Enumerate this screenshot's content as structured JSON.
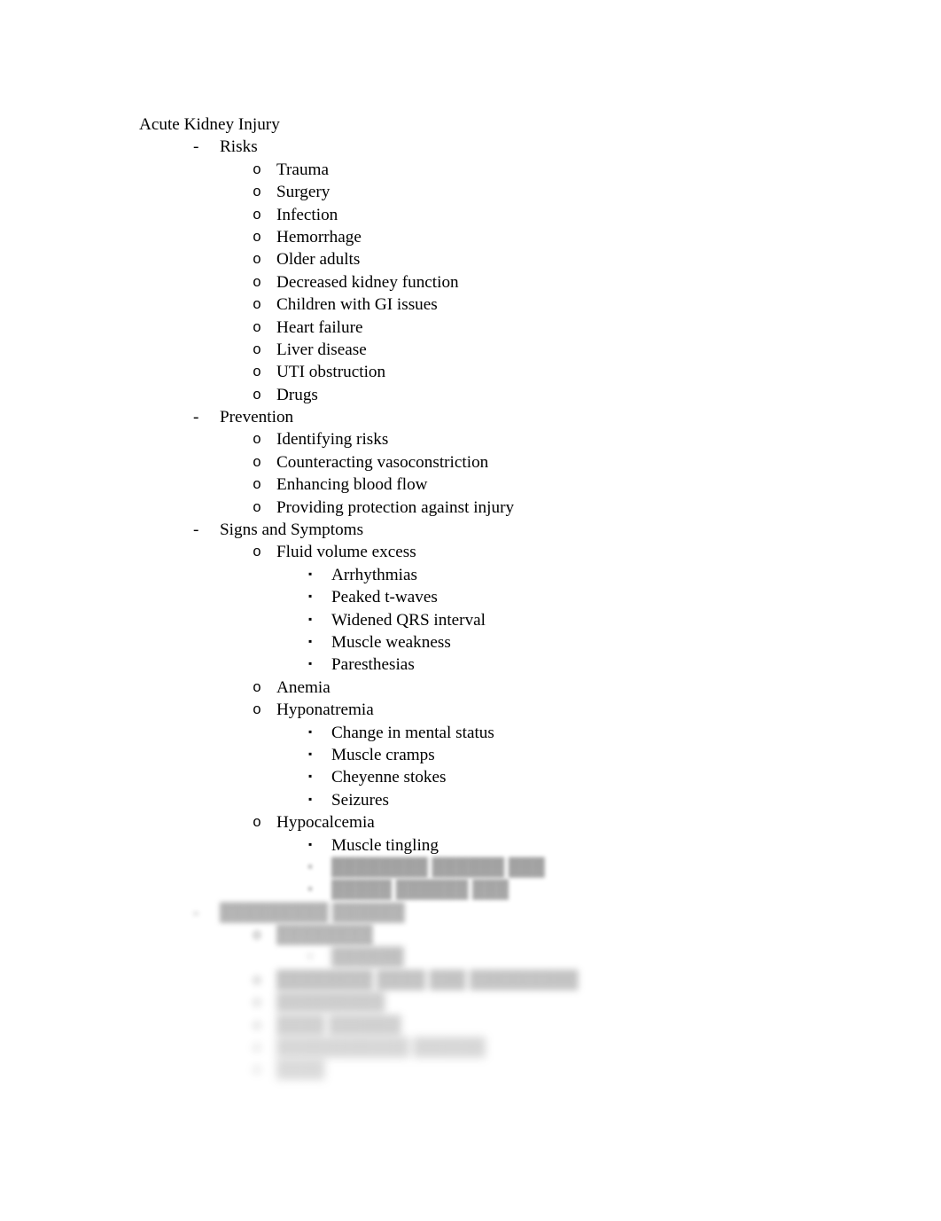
{
  "document": {
    "title": "Acute Kidney Injury",
    "markers": {
      "level1": "-",
      "level2": "o",
      "level3": "▪"
    },
    "outline": [
      {
        "level": 1,
        "text": "Risks"
      },
      {
        "level": 2,
        "text": "Trauma"
      },
      {
        "level": 2,
        "text": "Surgery"
      },
      {
        "level": 2,
        "text": "Infection"
      },
      {
        "level": 2,
        "text": "Hemorrhage"
      },
      {
        "level": 2,
        "text": "Older adults"
      },
      {
        "level": 2,
        "text": "Decreased kidney function"
      },
      {
        "level": 2,
        "text": "Children with GI issues"
      },
      {
        "level": 2,
        "text": "Heart failure"
      },
      {
        "level": 2,
        "text": "Liver disease"
      },
      {
        "level": 2,
        "text": "UTI obstruction"
      },
      {
        "level": 2,
        "text": "Drugs"
      },
      {
        "level": 1,
        "text": "Prevention"
      },
      {
        "level": 2,
        "text": "Identifying risks"
      },
      {
        "level": 2,
        "text": "Counteracting vasoconstriction"
      },
      {
        "level": 2,
        "text": "Enhancing blood flow"
      },
      {
        "level": 2,
        "text": "Providing protection against injury"
      },
      {
        "level": 1,
        "text": "Signs and Symptoms"
      },
      {
        "level": 2,
        "text": "Fluid volume excess"
      },
      {
        "level": 3,
        "text": "Arrhythmias"
      },
      {
        "level": 3,
        "text": "Peaked t-waves"
      },
      {
        "level": 3,
        "text": "Widened QRS interval"
      },
      {
        "level": 3,
        "text": "Muscle weakness"
      },
      {
        "level": 3,
        "text": "Paresthesias"
      },
      {
        "level": 2,
        "text": "Anemia"
      },
      {
        "level": 2,
        "text": "Hyponatremia"
      },
      {
        "level": 3,
        "text": "Change in mental status"
      },
      {
        "level": 3,
        "text": "Muscle cramps"
      },
      {
        "level": 3,
        "text": "Cheyenne stokes"
      },
      {
        "level": 3,
        "text": "Seizures"
      },
      {
        "level": 2,
        "text": "Hypocalcemia"
      },
      {
        "level": 3,
        "text": "Muscle tingling"
      }
    ],
    "obscured_outline": [
      {
        "level": 3,
        "text": "████████ ██████ ███",
        "blur": 1
      },
      {
        "level": 3,
        "text": "█████ ██████ ███",
        "blur": 1
      },
      {
        "level": 1,
        "text": "█████████ ██████",
        "blur": 2
      },
      {
        "level": 2,
        "text": "████████",
        "blur": 2
      },
      {
        "level": 3,
        "text": "██████",
        "blur": 3
      },
      {
        "level": 2,
        "text": "████████ ████ ███ █████████",
        "blur": 3
      },
      {
        "level": 2,
        "text": "█████████",
        "blur": 4
      },
      {
        "level": 2,
        "text": "████ ██████",
        "blur": 4
      },
      {
        "level": 2,
        "text": "███████████ ██████",
        "blur": 5
      },
      {
        "level": 2,
        "text": "████",
        "blur": 5
      }
    ]
  }
}
